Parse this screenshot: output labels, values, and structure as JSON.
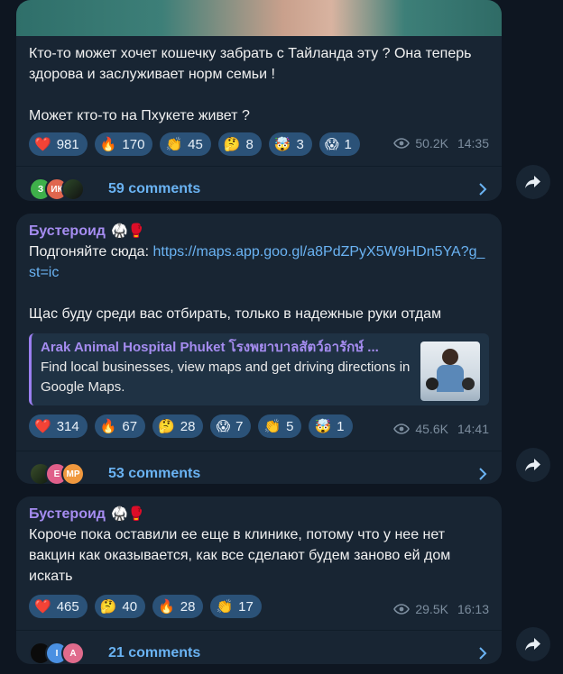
{
  "posts": [
    {
      "text_lines": [
        "Кто-то может хочет кошечку забрать с Тайланда эту ? Она теперь",
        "здорова и заслуживает норм семьи !",
        "Может кто-то на Пхукете живет ?"
      ],
      "reactions": [
        {
          "emoji": "❤️",
          "count": "981"
        },
        {
          "emoji": "🔥",
          "count": "170"
        },
        {
          "emoji": "👏",
          "count": "45"
        },
        {
          "emoji": "🤔",
          "count": "8"
        },
        {
          "emoji": "🤯",
          "count": "3"
        },
        {
          "emoji": "😱",
          "count": "1"
        }
      ],
      "views": "50.2K",
      "time": "14:35",
      "comment_avatars": [
        "З",
        "ИК",
        ""
      ],
      "comments": "59 comments"
    },
    {
      "author": "Бустероид",
      "author_emoji": "🥋🥊",
      "text_prefix": "Подгоняйте сюда: ",
      "link": "https://maps.app.goo.gl/a8PdZPyX5W9HDn5YA?g_st=ic",
      "text_after": "Щас буду среди вас отбирать, только в надежные руки отдам",
      "preview": {
        "title": "Arak Animal Hospital Phuket โรงพยาบาลสัตว์อารักษ์ ...",
        "description": "Find local businesses, view maps and get driving directions in Google Maps."
      },
      "reactions": [
        {
          "emoji": "❤️",
          "count": "314"
        },
        {
          "emoji": "🔥",
          "count": "67"
        },
        {
          "emoji": "🤔",
          "count": "28"
        },
        {
          "emoji": "😱",
          "count": "7"
        },
        {
          "emoji": "👏",
          "count": "5"
        },
        {
          "emoji": "🤯",
          "count": "1"
        }
      ],
      "views": "45.6K",
      "time": "14:41",
      "comment_avatars": [
        "",
        "E",
        "MP"
      ],
      "comments": "53 comments"
    },
    {
      "author": "Бустероид",
      "author_emoji": "🥋🥊",
      "text": "Короче пока оставили ее еще в клинике, потому что у нее нет вакцин как оказывается, как все сделают будем заново ей дом искать",
      "reactions": [
        {
          "emoji": "❤️",
          "count": "465"
        },
        {
          "emoji": "🤔",
          "count": "40"
        },
        {
          "emoji": "🔥",
          "count": "28"
        },
        {
          "emoji": "👏",
          "count": "17"
        }
      ],
      "views": "29.5K",
      "time": "16:13",
      "comment_avatars": [
        "",
        "I",
        "A"
      ],
      "comments": "21 comments"
    }
  ],
  "colors": {
    "background": "#0e1621",
    "bubble": "#182533",
    "reaction": "#2b5278",
    "author": "#a58cf0",
    "link": "#6ab3f3",
    "meta": "#7c8d9e"
  },
  "icons": {
    "views": "eye-icon",
    "comments_chevron": "chevron-right-icon",
    "share": "share-arrow-icon"
  }
}
